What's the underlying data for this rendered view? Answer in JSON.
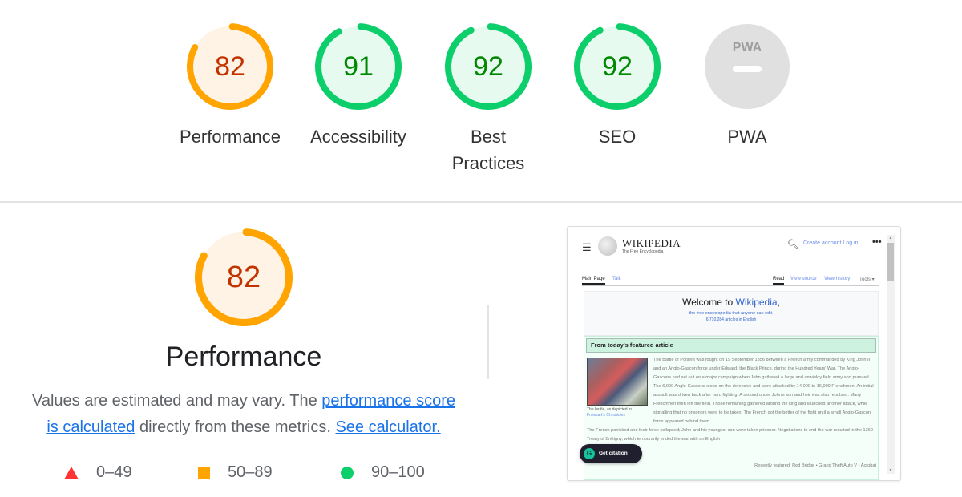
{
  "colors": {
    "average": "#ffa400",
    "average_bg": "#fff3e6",
    "average_text": "#c33300",
    "pass": "#0cce6b",
    "pass_bg": "#e6faf0",
    "pass_text": "#008800",
    "fail": "#ff3333",
    "na_bg": "#e0e0e0",
    "link": "#1a73e8"
  },
  "gauges": [
    {
      "id": "performance",
      "score": 82,
      "label": "Performance",
      "rating": "average"
    },
    {
      "id": "accessibility",
      "score": 91,
      "label": "Accessibility",
      "rating": "pass"
    },
    {
      "id": "best-practices",
      "score": 92,
      "label": "Best Practices",
      "rating": "pass"
    },
    {
      "id": "seo",
      "score": 92,
      "label": "SEO",
      "rating": "pass"
    },
    {
      "id": "pwa",
      "score": null,
      "label": "PWA",
      "rating": "na",
      "badge_text": "PWA"
    }
  ],
  "performance": {
    "score": 82,
    "title": "Performance",
    "description": {
      "before": "Values are estimated and may vary. The ",
      "link1": "performance score is calculated",
      "middle": " directly from these metrics. ",
      "link2": "See calculator."
    },
    "legend": [
      {
        "icon": "triangle-icon",
        "range": "0–49"
      },
      {
        "icon": "square-icon",
        "range": "50–89"
      },
      {
        "icon": "circle-icon",
        "range": "90–100"
      }
    ]
  },
  "screenshot": {
    "site_name": "WIKIPEDIA",
    "tagline": "The Free Encyclopedia",
    "menu_icon": "hamburger-icon",
    "search_icon": "search-icon",
    "header_links": "Create account   Log in",
    "more_icon": "ellipsis-icon",
    "tabs_left": [
      "Main Page",
      "Talk"
    ],
    "tabs_right": [
      "Read",
      "View source",
      "View history",
      "Tools ▾"
    ],
    "welcome_prefix": "Welcome to ",
    "welcome_link": "Wikipedia",
    "welcome_sub": "the free encyclopedia that anyone can edit.",
    "article_count": "6,710,284 articles in English",
    "featured_heading": "From today's featured article",
    "image_caption_prefix": "The battle, as depicted in",
    "image_caption_link": "Froissart's Chronicles",
    "featured_text": "The Battle of Poitiers was fought on 19 September 1356 between a French army commanded by King John II and an Anglo-Gascon force under Edward, the Black Prince, during the Hundred Years' War. The Anglo-Gascons had set out on a major campaign when John gathered a large and unwieldy field army and pursued. The 6,000 Anglo-Gascons stood on the defensive and were attacked by 14,000 to 16,000 Frenchmen. An initial assault was driven back after hard fighting. A second under John's son and heir was also repulsed. Many Frenchmen then left the field. Those remaining gathered around the king and launched another attack, while signalling that no prisoners were to be taken. The French got the better of the fight until a small Anglo-Gascon force appeared behind them.",
    "featured_text_2": "The French panicked and their force collapsed; John and his youngest son were taken prisoner. Negotiations to end the war resulted in the 1360 Treaty of Brétigny, which temporarily ended the war with an English",
    "recently_featured": "Recently featured: Red Bridge • Grand Theft Auto V • Acrobat",
    "citation_button": "Get citation",
    "citation_icon_letter": "G"
  }
}
